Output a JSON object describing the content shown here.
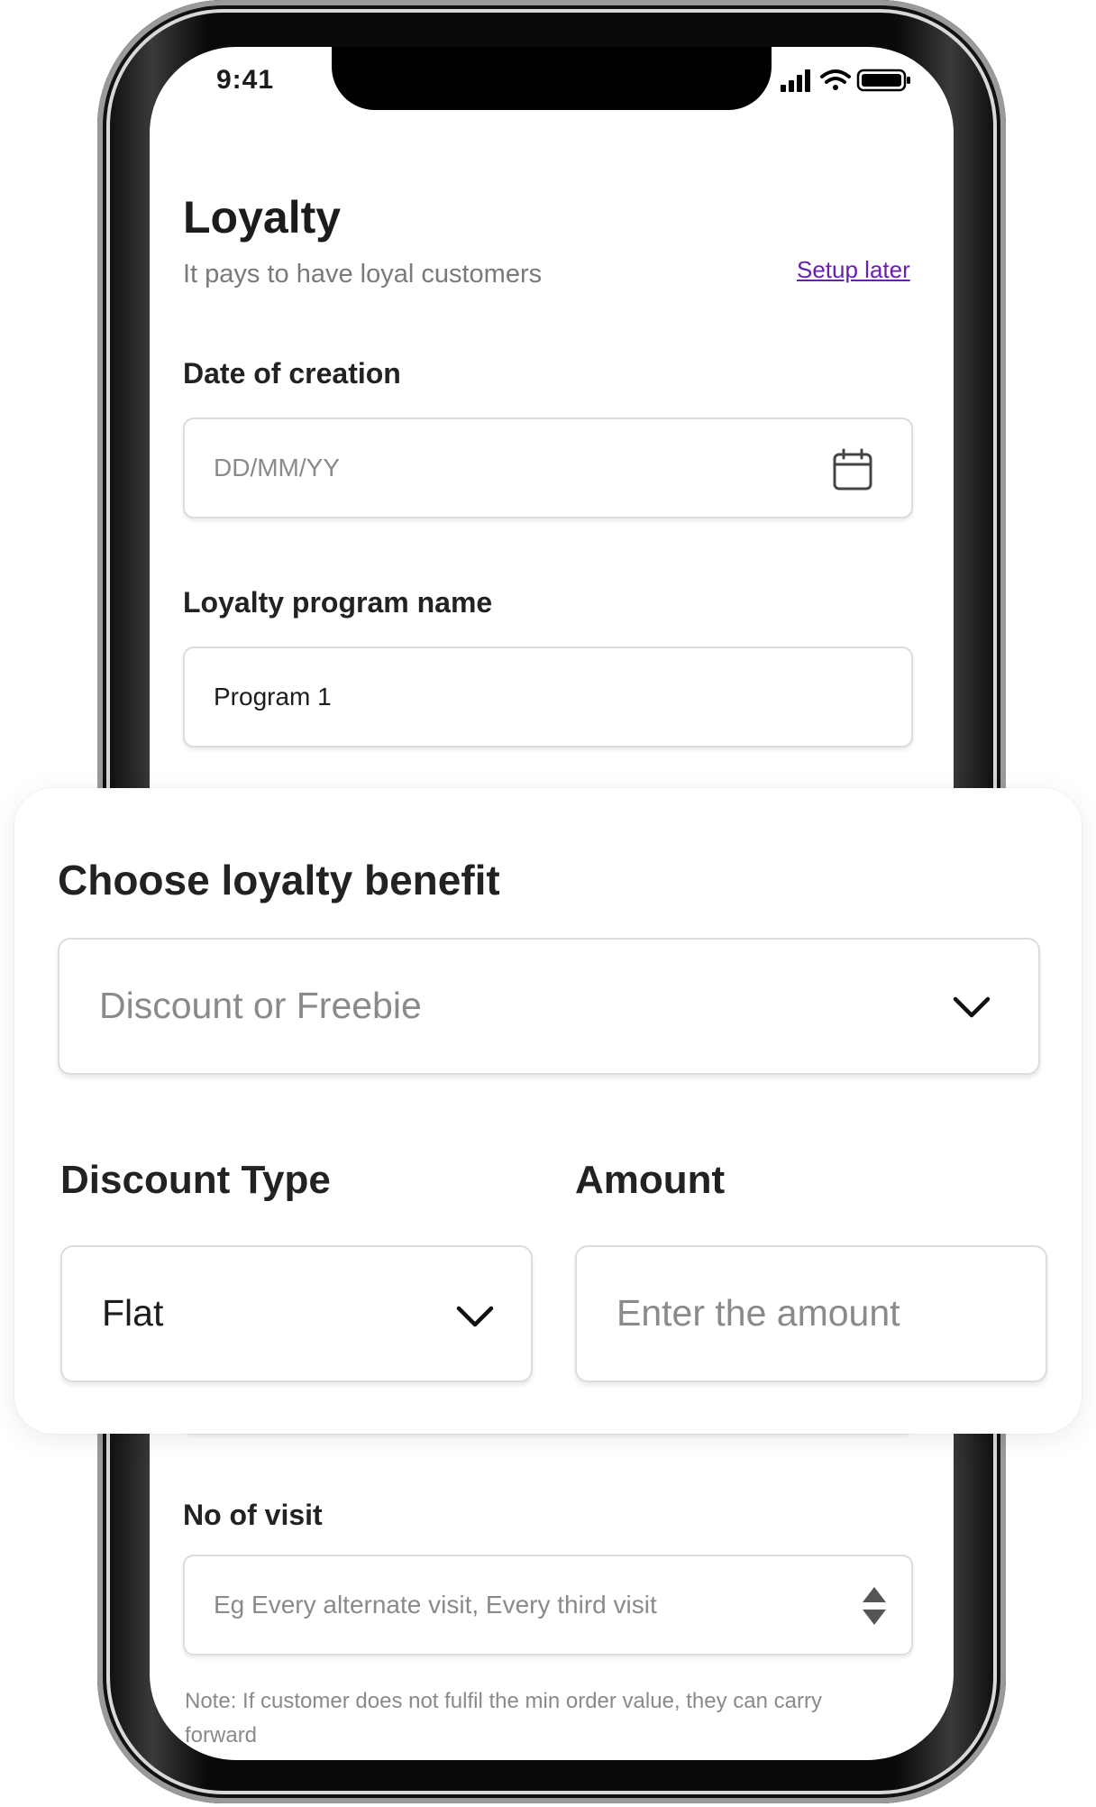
{
  "status_bar": {
    "time": "9:41"
  },
  "page": {
    "title": "Loyalty",
    "subtitle": "It pays to have loyal customers",
    "setup_later": "Setup later"
  },
  "date_of_creation": {
    "label": "Date of creation",
    "placeholder": "DD/MM/YY",
    "icon": "calendar-icon"
  },
  "program_name": {
    "label": "Loyalty program name",
    "value": "Program 1"
  },
  "loyalty_benefit_card": {
    "title": "Choose loyalty benefit",
    "benefit_select": {
      "placeholder": "Discount or Freebie",
      "icon": "chevron-down-icon"
    },
    "discount_type": {
      "label": "Discount Type",
      "value": "Flat",
      "icon": "chevron-down-icon"
    },
    "amount": {
      "label": "Amount",
      "placeholder": "Enter the amount"
    }
  },
  "no_of_visit": {
    "label": "No of visit",
    "placeholder": "Eg Every alternate visit, Every third visit",
    "icon": "stepper-icon"
  },
  "note": "Note: If customer does not fulfil the min order value, they can carry forward",
  "colors": {
    "link": "#6a1fb0",
    "placeholder": "#8a8a8a",
    "border": "#dcdcdc",
    "text": "#1c1c1e"
  }
}
